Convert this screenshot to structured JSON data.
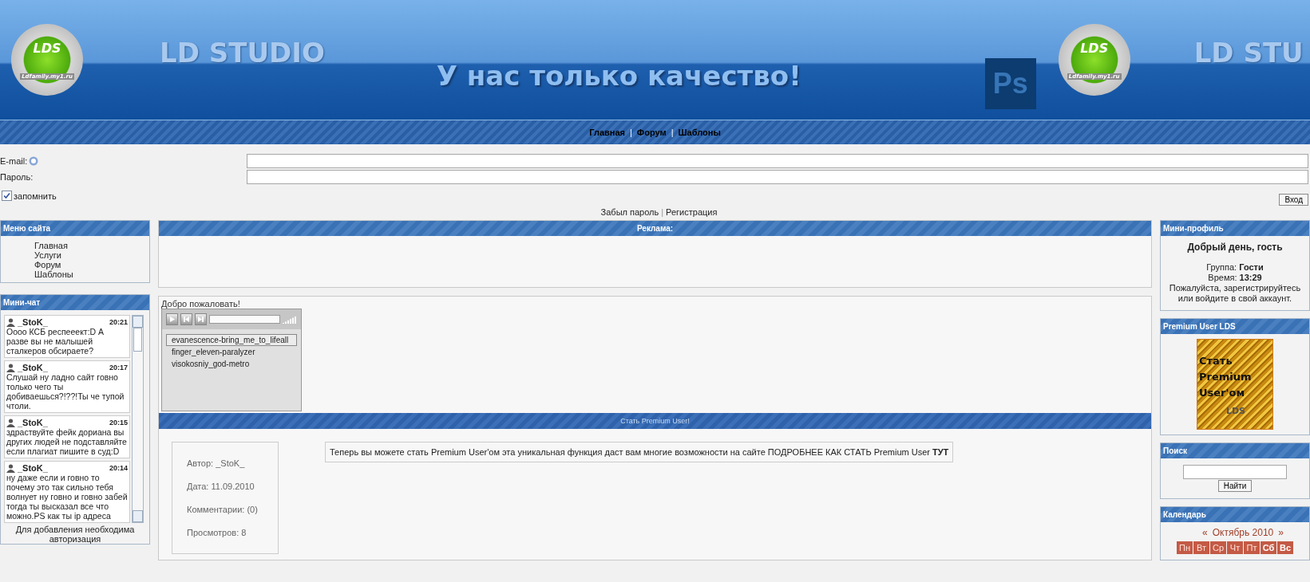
{
  "header": {
    "logos": [
      {
        "text": "LDS",
        "caption": "Ldfamily.my1.ru"
      },
      {
        "text": "LDS",
        "caption": "Ldfamily.my1.ru"
      }
    ],
    "brand": "LD STUDIO",
    "brand_repeat": "LD STU",
    "slogan": "У нас только качество!",
    "ps_badge": "Ps"
  },
  "nav": [
    {
      "kind": "link",
      "label": "Главная"
    },
    {
      "kind": "separator",
      "label": "|"
    },
    {
      "kind": "link",
      "label": "Форум"
    },
    {
      "kind": "separator",
      "label": "|"
    },
    {
      "kind": "link",
      "label": "Шаблоны"
    }
  ],
  "login": {
    "email_label": "E-mail:",
    "password_label": "Пароль:",
    "remember": {
      "label": "запомнить",
      "checked": true
    },
    "submit": "Вход",
    "links": [
      {
        "kind": "link",
        "label": "Забыл пароль"
      },
      {
        "kind": "separator",
        "label": "|"
      },
      {
        "kind": "link",
        "label": "Регистрация"
      }
    ]
  },
  "site_menu": {
    "title": "Меню сайта",
    "items": [
      "Главная",
      "Услуги",
      "Форум",
      "Шаблоны"
    ]
  },
  "mini_chat": {
    "title": "Мини-чат",
    "messages": [
      {
        "user": "_StoK_",
        "time": "20:21",
        "text": "Оооо КСБ респееект:D А разве вы не малышей сталкеров обсираете?"
      },
      {
        "user": "_StoK_",
        "time": "20:17",
        "text": "Слушай ну ладно сайт говно только чего ты добиваешься?!??!Ты че тупой чтоли."
      },
      {
        "user": "_StoK_",
        "time": "20:15",
        "text": "здраствуйте фейк дориана вы других людей не подставляйте если плагиат пишите в суд:D"
      },
      {
        "user": "_StoK_",
        "time": "20:14",
        "text": "ну даже если и говно то почему это так сильно тебя волнует ну говно и говно забей тогда ты высказал все что можно.PS как ты ip адреса"
      }
    ],
    "footer": "Для добавления необходима авторизация"
  },
  "ads": {
    "title": "Реклама:"
  },
  "welcome": "Добро пожаловать!",
  "player": {
    "progress": {
      "level": 0
    },
    "tracks": [
      {
        "name": "evanescence-bring_me_to_lifeall",
        "selected": true
      },
      {
        "name": "finger_eleven-paralyzer",
        "selected": false
      },
      {
        "name": "visokosniy_god-metro",
        "selected": false
      }
    ]
  },
  "post": {
    "title": "Стать Premium User!",
    "meta": [
      "Автор: _StoK_",
      "Дата: 11.09.2010",
      "Комментарии: (0)",
      "Просмотров: 8"
    ],
    "text": "Теперь вы можете стать Premium User'ом эта уникальная функция даст вам многие возможности на сайте ПОДРОБНЕЕ КАК СТАТЬ Premium User **ТУТ**"
  },
  "mini_profile": {
    "title": "Мини-профиль",
    "greeting": "Добрый день, гость",
    "group_label": "Группа:",
    "group": "Гости",
    "time_label": "Время:",
    "time": "13:29",
    "note": "Пожалуйста, зарегистрируйтесь или войдите в свой аккаунт."
  },
  "premium": {
    "title": "Premium User LDS",
    "banner_lines": [
      "Стать",
      "Premium",
      "User'ом"
    ],
    "banner_brand": "LDS"
  },
  "search": {
    "title": "Поиск",
    "button": "Найти"
  },
  "calendar": {
    "title": "Календарь",
    "prev": "«",
    "month": "Октябрь 2010",
    "next": "»",
    "days": [
      {
        "label": "Пн",
        "weekend": false
      },
      {
        "label": "Вт",
        "weekend": false
      },
      {
        "label": "Ср",
        "weekend": false
      },
      {
        "label": "Чт",
        "weekend": false
      },
      {
        "label": "Пт",
        "weekend": false
      },
      {
        "label": "Сб",
        "weekend": true
      },
      {
        "label": "Вс",
        "weekend": true
      }
    ]
  }
}
